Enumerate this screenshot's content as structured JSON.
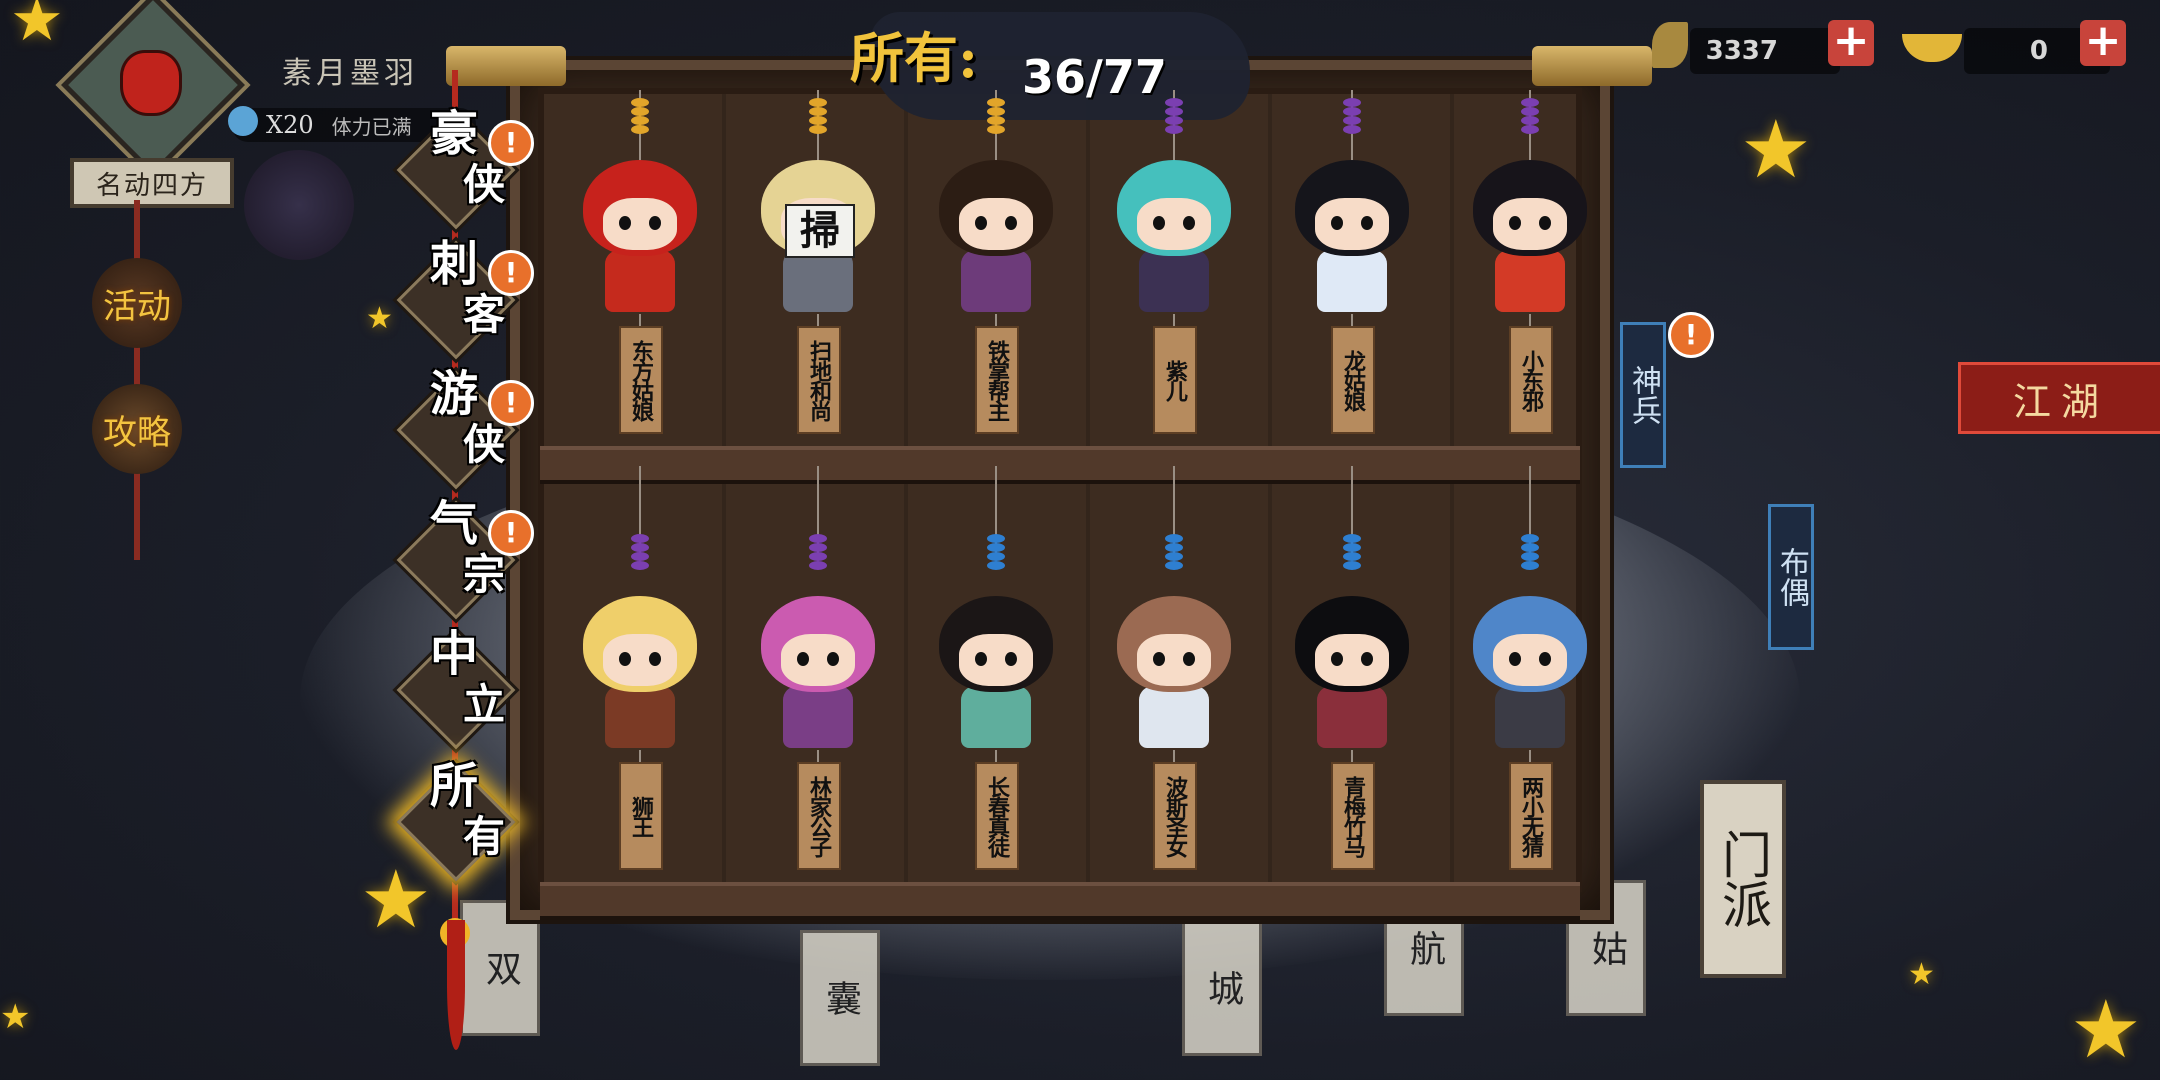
{
  "player": {
    "name": "素月墨羽",
    "rank_title": "名动四方",
    "stamina_count": "X20",
    "stamina_label": "体力已满"
  },
  "side_buttons": {
    "activity": "活动",
    "guide": "攻略"
  },
  "currency": {
    "leaf": "3337",
    "gold": "0"
  },
  "header": {
    "title": "所有:",
    "count": "36/77"
  },
  "categories": [
    {
      "label1": "豪",
      "label2": "侠",
      "alert": true
    },
    {
      "label1": "刺",
      "label2": "客",
      "alert": true
    },
    {
      "label1": "游",
      "label2": "侠",
      "alert": true
    },
    {
      "label1": "气",
      "label2": "宗",
      "alert": true
    },
    {
      "label1": "中",
      "label2": "立",
      "alert": false
    },
    {
      "label1": "所",
      "label2": "有",
      "alert": false,
      "active": true
    }
  ],
  "characters": [
    {
      "name": "东方姑娘",
      "hair": "#c7221c",
      "body": "#c52a1d",
      "bead": "#e2a52a"
    },
    {
      "name": "扫地和尚",
      "hair": "#e5d394",
      "body": "#6a6f7c",
      "bead": "#e2a52a",
      "sign": "掃"
    },
    {
      "name": "铁掌帮主",
      "hair": "#2c1d14",
      "body": "#6d3b7a",
      "bead": "#e2a52a"
    },
    {
      "name": "紫儿",
      "hair": "#45c0bd",
      "body": "#3c3153",
      "bead": "#7b3fb1"
    },
    {
      "name": "龙姑娘",
      "hair": "#15151b",
      "body": "#dfe9f6",
      "bead": "#7b3fb1"
    },
    {
      "name": "小东邪",
      "hair": "#17141a",
      "body": "#d33a26",
      "bead": "#7b3fb1"
    },
    {
      "name": "狮王",
      "hair": "#efcf6a",
      "body": "#7b3a25",
      "bead": "#7b3fb1"
    },
    {
      "name": "林家公子",
      "hair": "#cb5bb0",
      "body": "#7a3e86",
      "bead": "#7b3fb1"
    },
    {
      "name": "长春真徒",
      "hair": "#1b1616",
      "body": "#5fae9d",
      "bead": "#2e7fd1"
    },
    {
      "name": "波斯圣女",
      "hair": "#9b6a52",
      "body": "#dfe6ef",
      "bead": "#2e7fd1"
    },
    {
      "name": "青梅竹马",
      "hair": "#0d0d10",
      "body": "#8a2f3b",
      "bead": "#2e7fd1"
    },
    {
      "name": "两小无猜",
      "hair": "#4f86c9",
      "body": "#3b3b45",
      "bead": "#2e7fd1"
    }
  ],
  "right_tags": {
    "weapon": "神兵",
    "doll": "布偶",
    "jianghu": "江湖",
    "sect": "门派"
  },
  "background_tags": [
    "双",
    "囊",
    "城",
    "航",
    "姑"
  ]
}
